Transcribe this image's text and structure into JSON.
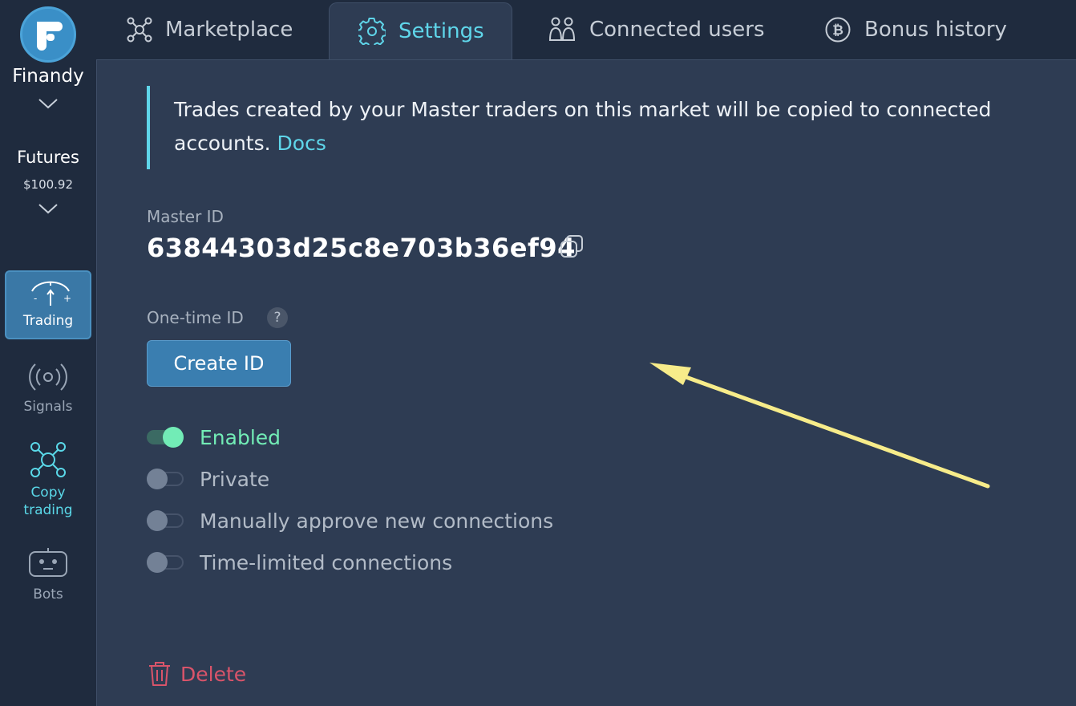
{
  "sidebar": {
    "brand": "Finandy",
    "account": {
      "type": "Futures",
      "balance": "$100.92"
    },
    "items": [
      {
        "label": "Trading",
        "icon": "gauge-icon",
        "active": true
      },
      {
        "label": "Signals",
        "icon": "broadcast-icon",
        "active": false
      },
      {
        "label": "Copy trading",
        "icon": "network-icon",
        "active": false,
        "highlight": true
      },
      {
        "label": "Bots",
        "icon": "robot-icon",
        "active": false
      }
    ]
  },
  "tabs": [
    {
      "label": "Marketplace",
      "icon": "network-icon"
    },
    {
      "label": "Settings",
      "icon": "gear-icon",
      "active": true
    },
    {
      "label": "Connected users",
      "icon": "users-icon"
    },
    {
      "label": "Bonus history",
      "icon": "bitcoin-icon"
    }
  ],
  "settings": {
    "info_text": "Trades created by your Master traders on this market will be copied to connected accounts.",
    "docs_link": "Docs",
    "master_id_label": "Master ID",
    "master_id": "63844303d25c8e703b36ef94",
    "one_time_id_label": "One-time ID",
    "help_glyph": "?",
    "create_id_button": "Create ID",
    "toggles": [
      {
        "label": "Enabled",
        "on": true
      },
      {
        "label": "Private",
        "on": false
      },
      {
        "label": "Manually approve new connections",
        "on": false
      },
      {
        "label": "Time-limited connections",
        "on": false
      }
    ],
    "delete_label": "Delete"
  },
  "colors": {
    "accent": "#5fd6ea",
    "enabled": "#72ecb6",
    "danger": "#d9546a",
    "button": "#3a7eb0",
    "annotation_arrow": "#f7ec8a"
  }
}
